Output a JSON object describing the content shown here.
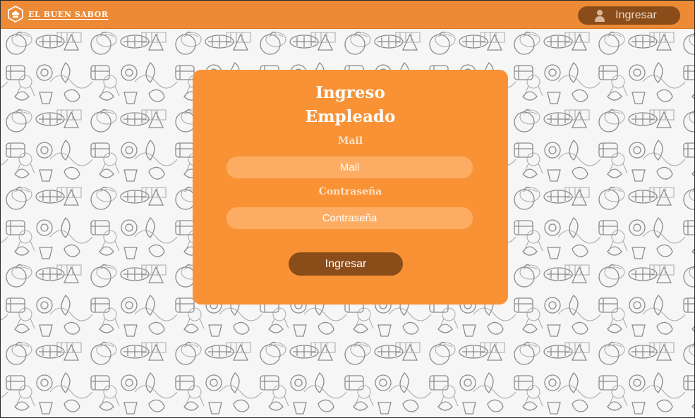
{
  "brand": {
    "name": "EL BUEN SABOR",
    "logo_icon": "chef-hat-logo-icon"
  },
  "header": {
    "login_label": "Ingresar",
    "login_icon": "user-icon"
  },
  "login_card": {
    "title_line1": "Ingreso",
    "title_line2": "Empleado",
    "email_label": "Mail",
    "email_placeholder": "Mail",
    "password_label": "Contraseña",
    "password_placeholder": "Contraseña",
    "submit_label": "Ingresar"
  },
  "colors": {
    "header": "#ec8a35",
    "card": "#f99235",
    "input": "#fcad63",
    "button": "#8a4c19",
    "background": "#f6f6f6"
  }
}
